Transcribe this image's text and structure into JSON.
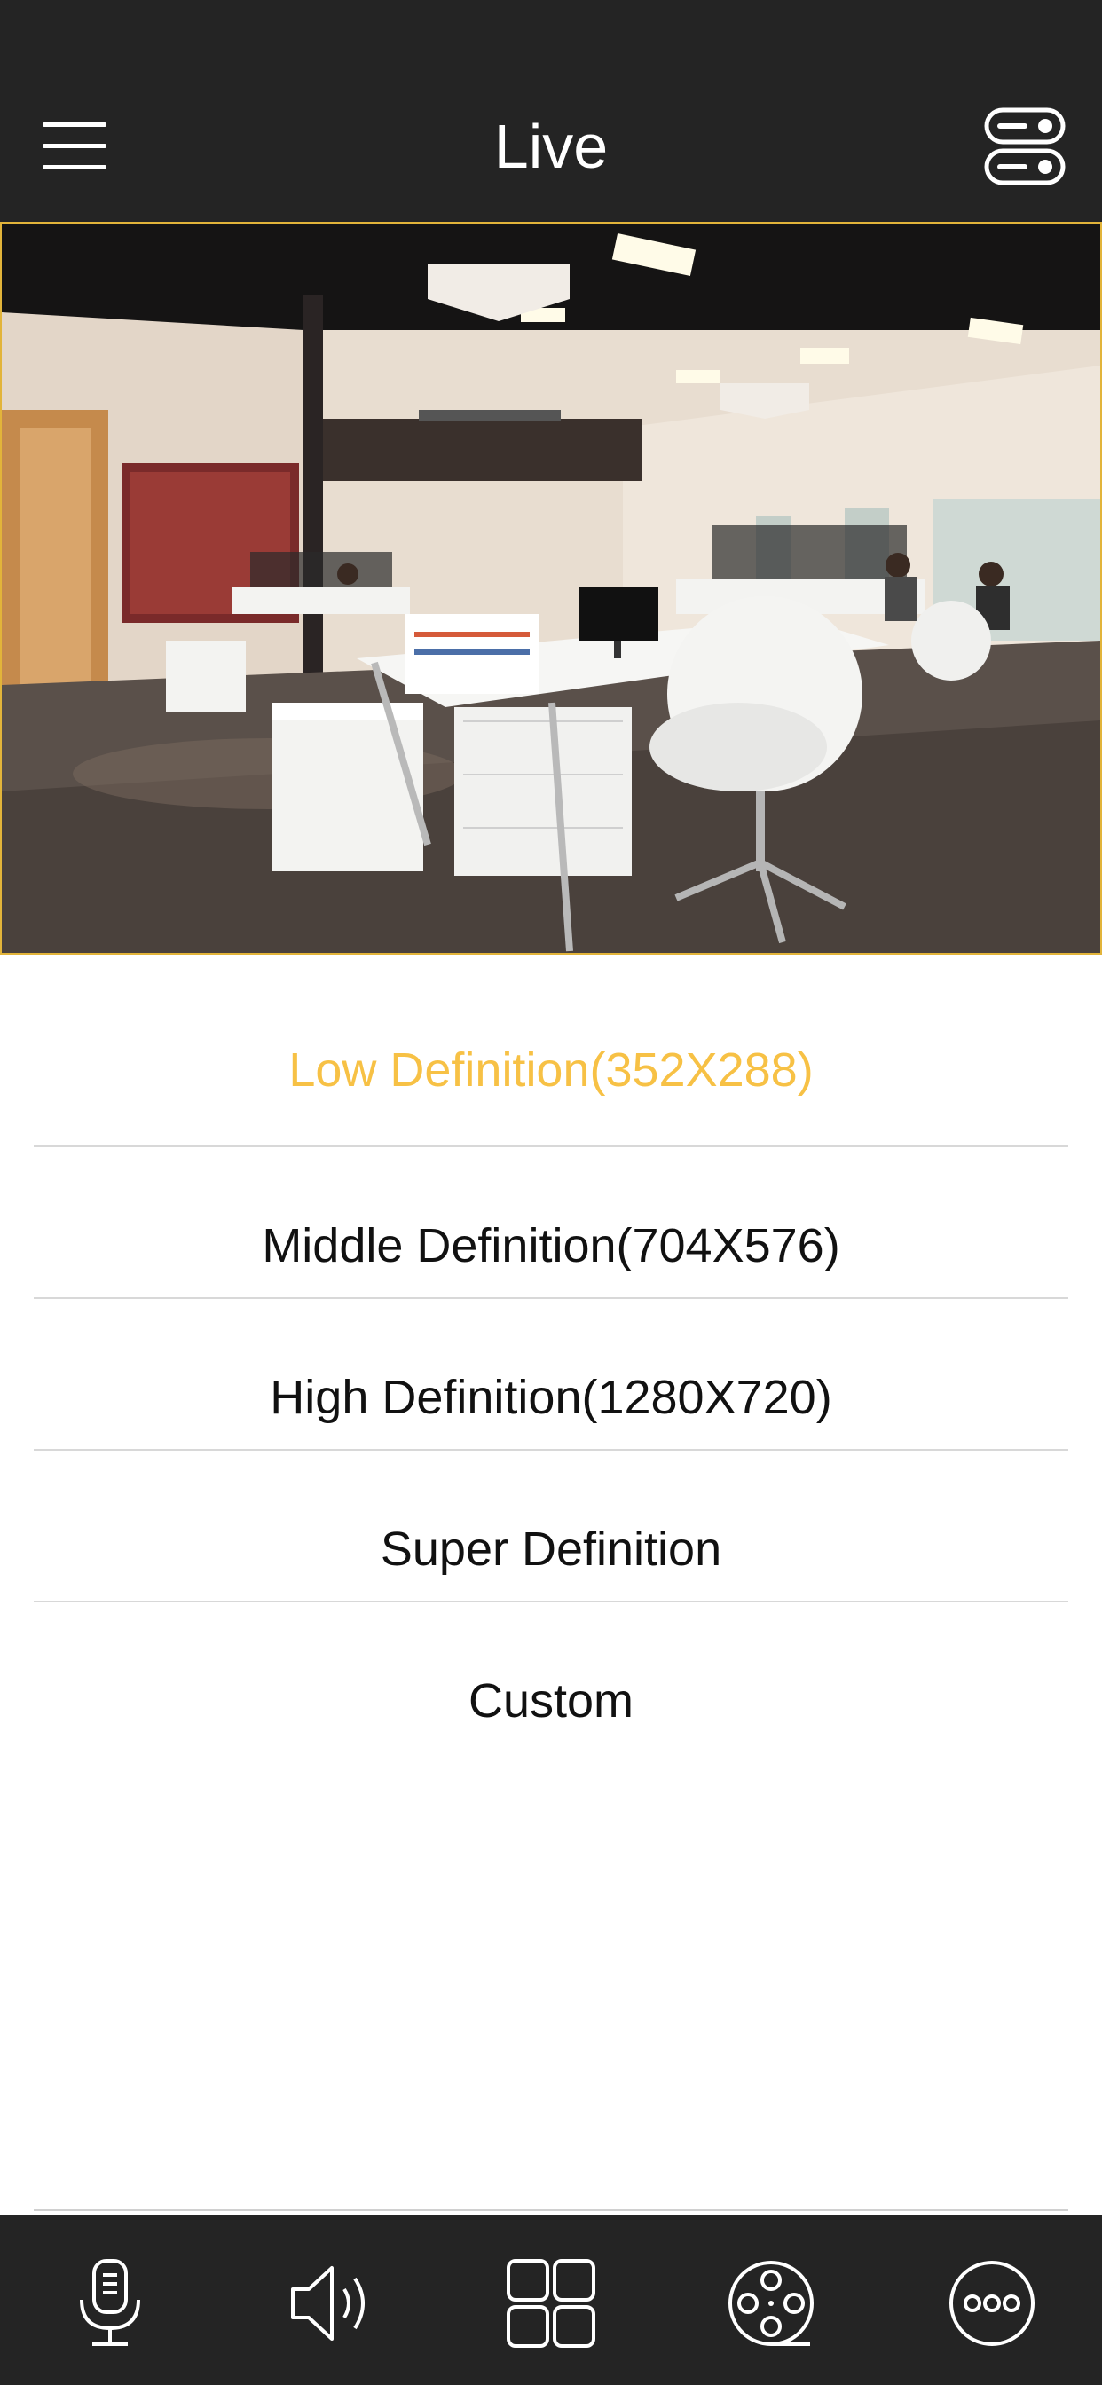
{
  "header": {
    "title": "Live",
    "menu_icon": "hamburger-menu-icon",
    "settings_icon": "toggle-settings-icon"
  },
  "video": {
    "description_icon": "live-camera-feed"
  },
  "resolution_options": [
    {
      "label": "Low Definition(352X288)",
      "selected": true
    },
    {
      "label": "Middle Definition(704X576)",
      "selected": false
    },
    {
      "label": "High Definition(1280X720)",
      "selected": false
    },
    {
      "label": "Super Definition",
      "selected": false
    },
    {
      "label": "Custom",
      "selected": false
    }
  ],
  "bottom_bar": {
    "icons": [
      "microphone-icon",
      "speaker-icon",
      "grid-view-icon",
      "film-reel-icon",
      "more-icon"
    ]
  },
  "colors": {
    "bar_background": "#242424",
    "accent": "#f7c145",
    "text": "#111111",
    "divider": "#d8d8d8"
  }
}
